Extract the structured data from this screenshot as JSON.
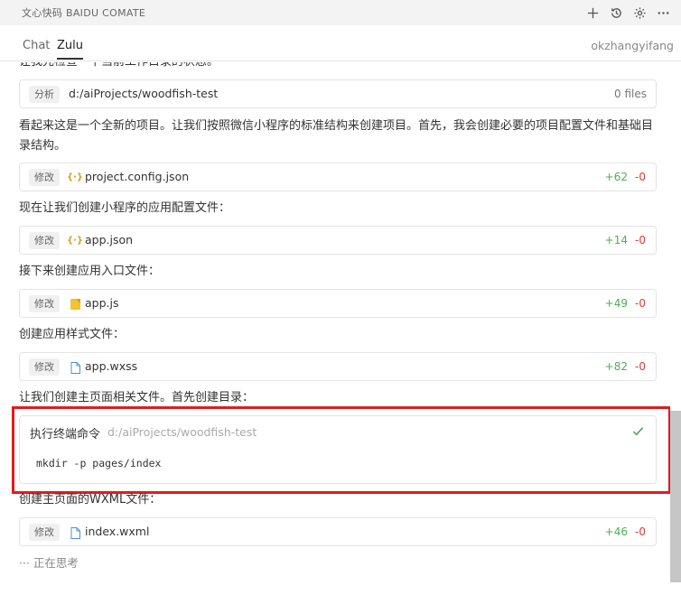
{
  "app": {
    "title": "文心快码 BAIDU COMATE"
  },
  "toolbar": {
    "icons": [
      "plus-icon",
      "history-icon",
      "gear-icon",
      "more-icon"
    ]
  },
  "tabs": [
    {
      "label": "Chat",
      "active": false
    },
    {
      "label": "Zulu",
      "active": true
    }
  ],
  "user": {
    "name": "okzhangyifang"
  },
  "messages": {
    "intro_cut": "让我先检查一下当前工作目录的状态。",
    "p1": "看起来这是一个全新的项目。让我们按照微信小程序的标准结构来创建项目。首先，我会创建必要的项目配置文件和基础目录结构。",
    "p2": "现在让我们创建小程序的应用配置文件：",
    "p3": "接下来创建应用入口文件：",
    "p4": "创建应用样式文件：",
    "p5": "让我们创建主页面相关文件。首先创建目录：",
    "p6": "创建主页面的WXML文件："
  },
  "analyze": {
    "tag": "分析",
    "path": "d:/aiProjects/woodfish-test",
    "count": "0 files"
  },
  "edits": [
    {
      "tag": "修改",
      "file": "project.config.json",
      "icon": "json-icon",
      "added": "+62",
      "removed": "-0"
    },
    {
      "tag": "修改",
      "file": "app.json",
      "icon": "json-icon",
      "added": "+14",
      "removed": "-0"
    },
    {
      "tag": "修改",
      "file": "app.js",
      "icon": "js-file-icon",
      "added": "+49",
      "removed": "-0"
    },
    {
      "tag": "修改",
      "file": "app.wxss",
      "icon": "file-icon",
      "added": "+82",
      "removed": "-0"
    },
    {
      "tag": "修改",
      "file": "index.wxml",
      "icon": "file-icon",
      "added": "+46",
      "removed": "-0"
    }
  ],
  "terminal": {
    "title": "执行终端命令",
    "path": "d:/aiProjects/woodfish-test",
    "command": "mkdir -p pages/index",
    "status": "done"
  },
  "status": {
    "thinking": "··· 正在思考"
  },
  "colors": {
    "added": "#4caf50",
    "removed": "#e53935",
    "highlight": "#e21b1b",
    "check": "#3fa34d"
  }
}
